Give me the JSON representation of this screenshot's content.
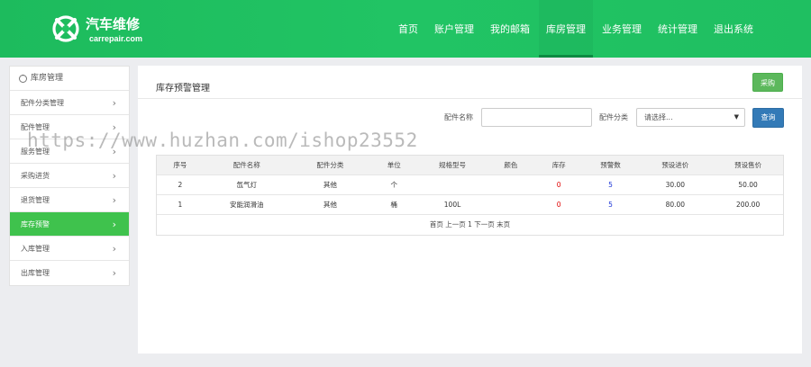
{
  "header": {
    "logo_title": "汽车维修",
    "logo_sub": "carrepair.com",
    "nav": [
      {
        "label": "首页",
        "active": false
      },
      {
        "label": "账户管理",
        "active": false
      },
      {
        "label": "我的邮箱",
        "active": false
      },
      {
        "label": "库房管理",
        "active": true
      },
      {
        "label": "业务管理",
        "active": false
      },
      {
        "label": "统计管理",
        "active": false
      },
      {
        "label": "退出系统",
        "active": false
      }
    ]
  },
  "sidebar": {
    "title": "库房管理",
    "items": [
      {
        "label": "配件分类管理"
      },
      {
        "label": "配件管理"
      },
      {
        "label": "服务管理"
      },
      {
        "label": "采购进货"
      },
      {
        "label": "退货管理"
      },
      {
        "label": "库存预警"
      },
      {
        "label": "入库管理"
      },
      {
        "label": "出库管理"
      }
    ]
  },
  "main": {
    "title": "库存预警管理",
    "buy_label": "采购",
    "search": {
      "name_label": "配件名称",
      "name_value": "",
      "category_label": "配件分类",
      "category_value": "请选择...",
      "query_label": "查询"
    },
    "table": {
      "columns": [
        "序号",
        "配件名称",
        "配件分类",
        "单位",
        "规格型号",
        "颜色",
        "库存",
        "预警数",
        "预设进价",
        "预设售价"
      ],
      "rows": [
        [
          "2",
          "氙气灯",
          "其他",
          "个",
          "",
          "",
          "0",
          "5",
          "30.00",
          "50.00"
        ],
        [
          "1",
          "安能润滑油",
          "其他",
          "桶",
          "100L",
          "",
          "0",
          "5",
          "80.00",
          "200.00"
        ]
      ]
    },
    "pager": "首页 上一页 1 下一页 末页"
  },
  "watermark": "https://www.huzhan.com/ishop23552",
  "colors": {
    "header_green": "#1fbf61",
    "active_green": "#3fc24d",
    "buy_green": "#5cb85c",
    "query_blue": "#337ab7",
    "stock_red": "#e00000",
    "warn_blue": "#1a33d6"
  }
}
